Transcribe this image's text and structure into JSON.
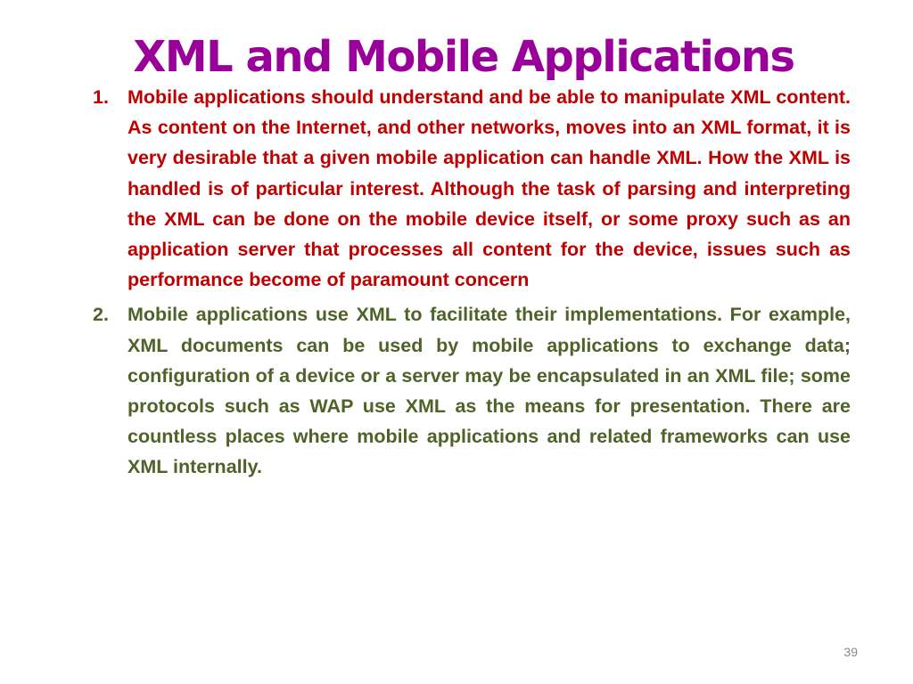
{
  "slide": {
    "title": "XML and Mobile Applications",
    "items": [
      {
        "number": "1.",
        "text": "Mobile applications should understand and be able to manipulate XML content. As content on the Internet, and other networks, moves into an XML format, it is very desirable that a given mobile application can handle XML. How the XML is handled is of particular interest. Although the task of parsing and interpreting the XML can be done on the mobile device itself, or some proxy such as an application server that processes all content for the device, issues such as performance become of paramount concern",
        "color": "#C00000"
      },
      {
        "number": "2.",
        "text": "Mobile applications use XML to facilitate their implementations. For example, XML documents can be used by mobile applications to exchange data; configuration of a device or a server may be encapsulated in an XML file; some protocols such as WAP use XML as the means for presentation. There are countless places where mobile applications and related frameworks can use XML internally.",
        "color": "#4F6228"
      }
    ],
    "page_number": "39",
    "title_color": "#990099"
  }
}
